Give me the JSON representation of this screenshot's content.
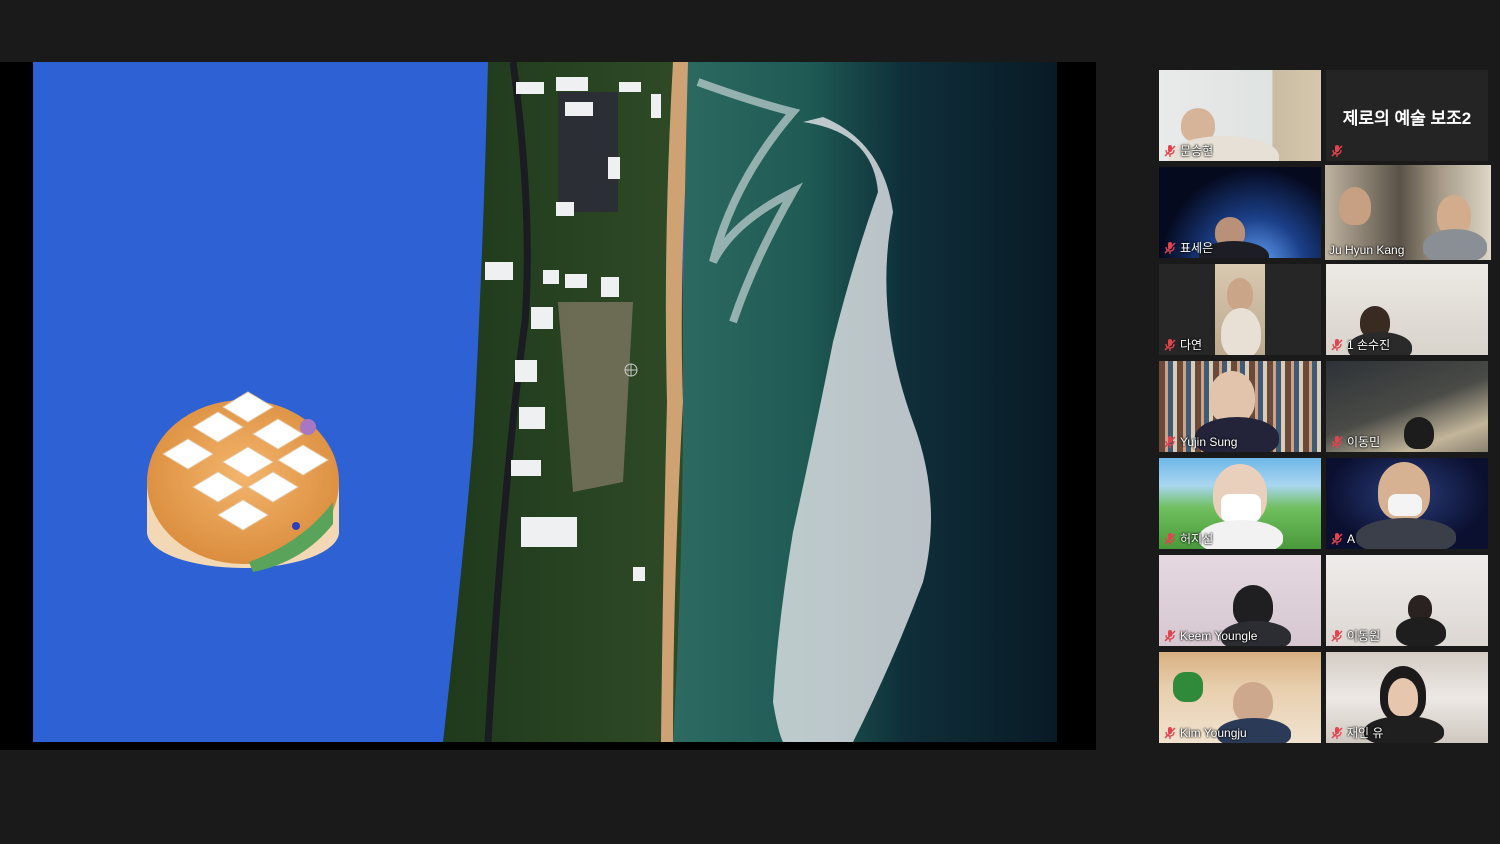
{
  "share": {
    "title": "shared-screen"
  },
  "participants": [
    {
      "name": "문승현",
      "muted": true,
      "active": false
    },
    {
      "name": "제로의 예술 보조2",
      "muted": true,
      "active": false,
      "video": false
    },
    {
      "name": "표세은",
      "muted": true,
      "active": false
    },
    {
      "name": "Ju Hyun Kang",
      "muted": false,
      "active": true
    },
    {
      "name": "다연",
      "muted": true,
      "active": false
    },
    {
      "name": "1 손수진",
      "muted": true,
      "active": false
    },
    {
      "name": "Yujin Sung",
      "muted": true,
      "active": false
    },
    {
      "name": "이동민",
      "muted": true,
      "active": false
    },
    {
      "name": "허지선",
      "muted": true,
      "active": false
    },
    {
      "name": "A",
      "muted": true,
      "active": false
    },
    {
      "name": "Keem Youngle",
      "muted": true,
      "active": false
    },
    {
      "name": "이동원",
      "muted": true,
      "active": false
    },
    {
      "name": "Kim Youngju",
      "muted": true,
      "active": false
    },
    {
      "name": "재인 유",
      "muted": true,
      "active": false
    }
  ],
  "icons": {
    "muted_mic": "muted-mic-icon"
  },
  "colors": {
    "active_speaker_border": "#e8e35a",
    "muted_icon": "#e0454f",
    "background": "#1a1a1a"
  }
}
